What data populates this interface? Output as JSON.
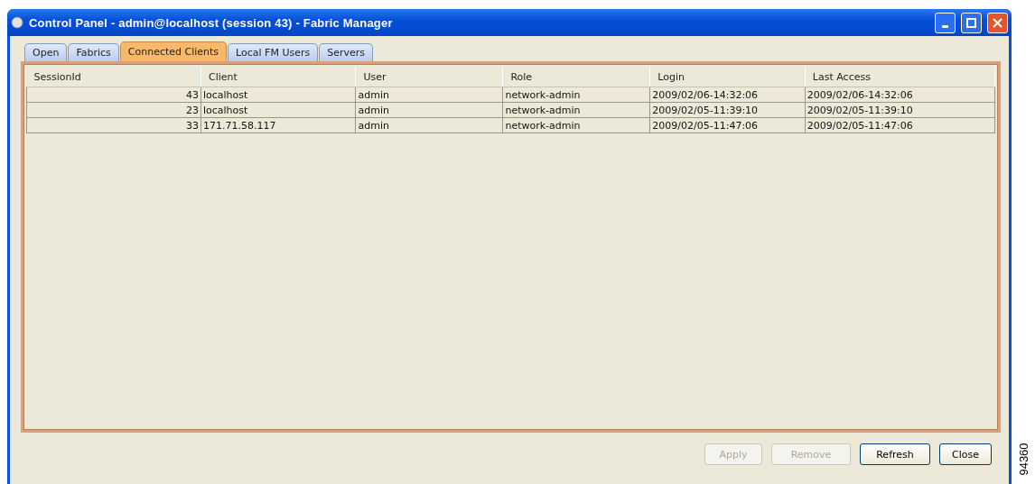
{
  "window": {
    "title": "Control Panel - admin@localhost (session 43) - Fabric Manager"
  },
  "tabs": [
    {
      "label": "Open",
      "selected": false
    },
    {
      "label": "Fabrics",
      "selected": false
    },
    {
      "label": "Connected Clients",
      "selected": true
    },
    {
      "label": "Local FM Users",
      "selected": false
    },
    {
      "label": "Servers",
      "selected": false
    }
  ],
  "table": {
    "columns": [
      "SessionId",
      "Client",
      "User",
      "Role",
      "Login",
      "Last Access"
    ],
    "rows": [
      [
        "43",
        "localhost",
        "admin",
        "network-admin",
        "2009/02/06-14:32:06",
        "2009/02/06-14:32:06"
      ],
      [
        "23",
        "localhost",
        "admin",
        "network-admin",
        "2009/02/05-11:39:10",
        "2009/02/05-11:39:10"
      ],
      [
        "33",
        "171.71.58.117",
        "admin",
        "network-admin",
        "2009/02/05-11:47:06",
        "2009/02/05-11:47:06"
      ]
    ]
  },
  "buttons": [
    {
      "label": "Apply",
      "disabled": true
    },
    {
      "label": "Remove",
      "disabled": true
    },
    {
      "label": "Refresh",
      "disabled": false
    },
    {
      "label": "Close",
      "disabled": false
    }
  ],
  "figure_id": "94360"
}
